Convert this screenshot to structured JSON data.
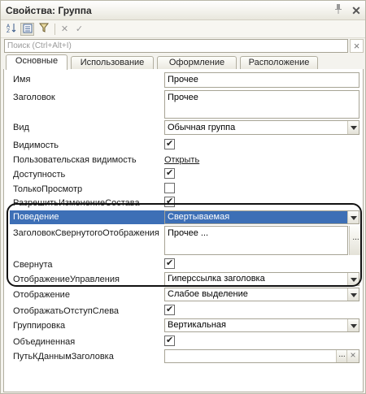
{
  "window": {
    "title": "Свойства: Группа",
    "pin_icon": "pin-icon",
    "close_icon": "close-icon"
  },
  "search": {
    "placeholder": "Поиск (Ctrl+Alt+I)",
    "clear_symbol": "×"
  },
  "tabs": [
    {
      "label": "Основные",
      "active": true
    },
    {
      "label": "Использование",
      "active": false
    },
    {
      "label": "Оформление",
      "active": false
    },
    {
      "label": "Расположение",
      "active": false
    }
  ],
  "properties": {
    "name": {
      "label": "Имя",
      "value": "Прочее"
    },
    "title": {
      "label": "Заголовок",
      "value": "Прочее"
    },
    "kind": {
      "label": "Вид",
      "value": "Обычная группа"
    },
    "visibility": {
      "label": "Видимость",
      "checked": true
    },
    "user_visibility": {
      "label": "Пользовательская видимость",
      "link": "Открыть"
    },
    "enabled": {
      "label": "Доступность",
      "checked": true
    },
    "readonly": {
      "label": "ТолькоПросмотр",
      "checked": false
    },
    "allow_change": {
      "label": "РазрешитьИзменениеСостава",
      "checked": true
    },
    "behavior": {
      "label": "Поведение",
      "value": "Свертываемая"
    },
    "collapsed_title": {
      "label": "ЗаголовокСвернутогоОтображения",
      "value": "Прочее ..."
    },
    "collapsed": {
      "label": "Свернута",
      "checked": true
    },
    "control_repr": {
      "label": "ОтображениеУправления",
      "value": "Гиперссылка заголовка"
    },
    "representation": {
      "label": "Отображение",
      "value": "Слабое выделение"
    },
    "show_left_margin": {
      "label": "ОтображатьОтступСлева",
      "checked": true
    },
    "grouping": {
      "label": "Группировка",
      "value": "Вертикальная"
    },
    "united": {
      "label": "Объединенная",
      "checked": true
    },
    "title_data_path": {
      "label": "ПутьКДаннымЗаголовка",
      "value": ""
    }
  },
  "ellipsis": "...",
  "colors": {
    "selection": "#3d6fb6",
    "panel": "#f4f3ee"
  }
}
